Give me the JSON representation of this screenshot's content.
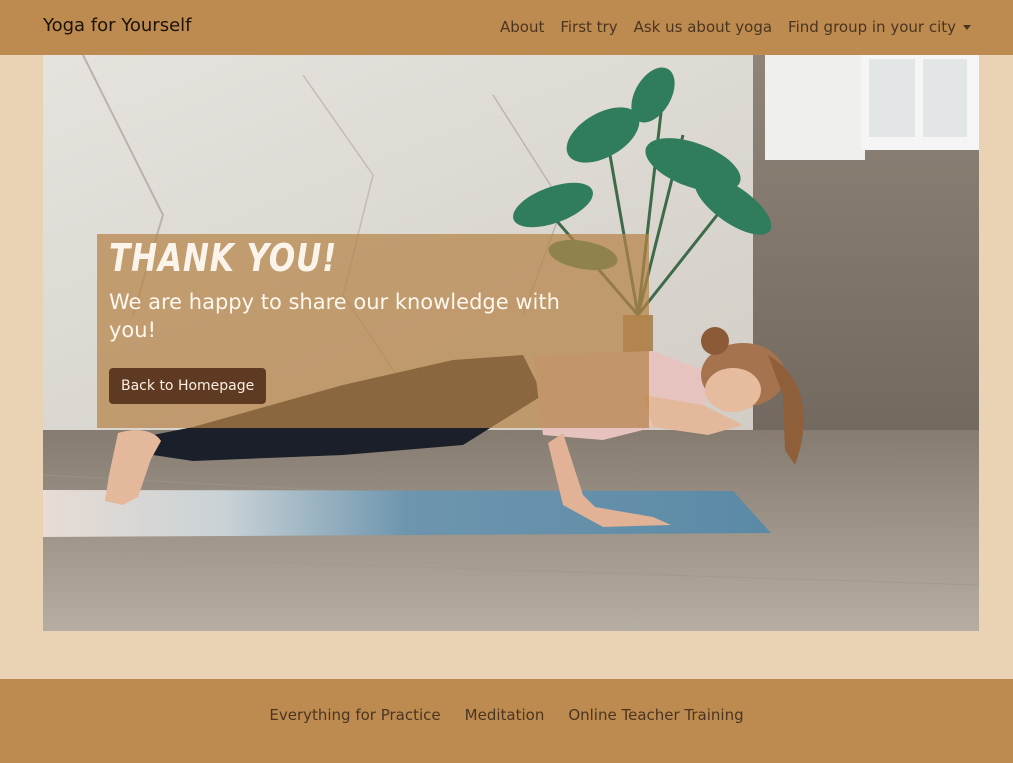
{
  "navbar": {
    "brand": "Yoga for Yourself",
    "links": [
      {
        "label": "About"
      },
      {
        "label": "First try"
      },
      {
        "label": "Ask us about yoga"
      },
      {
        "label": "Find group in your city"
      }
    ]
  },
  "hero": {
    "title": "THANK YOU!",
    "subtitle": "We are happy to share our knowledge with you!",
    "button_label": "Back to Homepage"
  },
  "footer": {
    "links": [
      {
        "label": "Everything for Practice"
      },
      {
        "label": "Meditation"
      },
      {
        "label": "Online Teacher Training"
      }
    ]
  },
  "colors": {
    "navbar_bg": "#bd8b50",
    "page_bg": "#ead3b5",
    "button_bg": "#5e3a22"
  }
}
